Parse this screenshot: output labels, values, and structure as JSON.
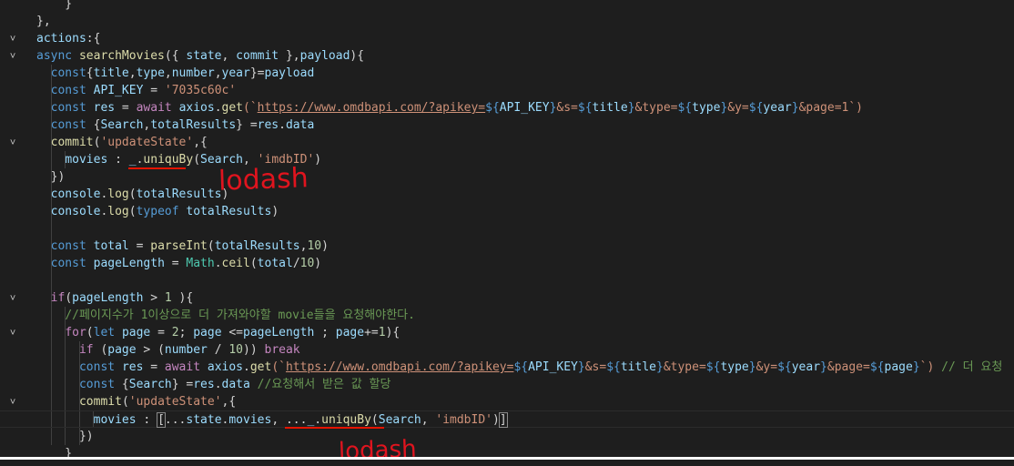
{
  "editor": {
    "lines": [
      {
        "fold": false,
        "segs": [
          {
            "t": "    }",
            "c": ""
          }
        ]
      },
      {
        "fold": false,
        "segs": [
          {
            "t": "},",
            "c": ""
          }
        ]
      },
      {
        "fold": true,
        "segs": [
          {
            "t": "actions",
            "c": "var"
          },
          {
            "t": ":{",
            "c": ""
          }
        ]
      },
      {
        "fold": true,
        "segs": [
          {
            "t": "async",
            "c": "kw"
          },
          {
            "t": " ",
            "c": ""
          },
          {
            "t": "searchMovies",
            "c": "fn"
          },
          {
            "t": "({ ",
            "c": ""
          },
          {
            "t": "state",
            "c": "var"
          },
          {
            "t": ", ",
            "c": ""
          },
          {
            "t": "commit",
            "c": "var"
          },
          {
            "t": " },",
            "c": ""
          },
          {
            "t": "payload",
            "c": "var"
          },
          {
            "t": "){",
            "c": ""
          }
        ]
      },
      {
        "fold": false,
        "segs": [
          {
            "t": "  ",
            "c": ""
          },
          {
            "t": "const",
            "c": "kw"
          },
          {
            "t": "{",
            "c": ""
          },
          {
            "t": "title",
            "c": "var"
          },
          {
            "t": ",",
            "c": ""
          },
          {
            "t": "type",
            "c": "var"
          },
          {
            "t": ",",
            "c": ""
          },
          {
            "t": "number",
            "c": "var"
          },
          {
            "t": ",",
            "c": ""
          },
          {
            "t": "year",
            "c": "var"
          },
          {
            "t": "}=",
            "c": ""
          },
          {
            "t": "payload",
            "c": "var"
          }
        ]
      },
      {
        "fold": false,
        "segs": [
          {
            "t": "  ",
            "c": ""
          },
          {
            "t": "const",
            "c": "kw"
          },
          {
            "t": " ",
            "c": ""
          },
          {
            "t": "API_KEY",
            "c": "var"
          },
          {
            "t": " = ",
            "c": ""
          },
          {
            "t": "'7035c60c'",
            "c": "str"
          }
        ]
      },
      {
        "fold": false,
        "segs": [
          {
            "t": "  ",
            "c": ""
          },
          {
            "t": "const",
            "c": "kw"
          },
          {
            "t": " ",
            "c": ""
          },
          {
            "t": "res",
            "c": "var"
          },
          {
            "t": " = ",
            "c": ""
          },
          {
            "t": "await",
            "c": "ctl"
          },
          {
            "t": " ",
            "c": ""
          },
          {
            "t": "axios",
            "c": "var"
          },
          {
            "t": ".",
            "c": ""
          },
          {
            "t": "get",
            "c": "fn"
          },
          {
            "t": "(`",
            "c": "str"
          },
          {
            "t": "https://www.omdbapi.com/?apikey=",
            "c": "link"
          },
          {
            "t": "${",
            "c": "interp"
          },
          {
            "t": "API_KEY",
            "c": "var"
          },
          {
            "t": "}",
            "c": "interp"
          },
          {
            "t": "&s=",
            "c": "str"
          },
          {
            "t": "${",
            "c": "interp"
          },
          {
            "t": "title",
            "c": "var"
          },
          {
            "t": "}",
            "c": "interp"
          },
          {
            "t": "&type=",
            "c": "str"
          },
          {
            "t": "${",
            "c": "interp"
          },
          {
            "t": "type",
            "c": "var"
          },
          {
            "t": "}",
            "c": "interp"
          },
          {
            "t": "&y=",
            "c": "str"
          },
          {
            "t": "${",
            "c": "interp"
          },
          {
            "t": "year",
            "c": "var"
          },
          {
            "t": "}",
            "c": "interp"
          },
          {
            "t": "&page=1",
            "c": "str"
          },
          {
            "t": "`)",
            "c": "str"
          }
        ]
      },
      {
        "fold": false,
        "segs": [
          {
            "t": "  ",
            "c": ""
          },
          {
            "t": "const",
            "c": "kw"
          },
          {
            "t": " {",
            "c": ""
          },
          {
            "t": "Search",
            "c": "var"
          },
          {
            "t": ",",
            "c": ""
          },
          {
            "t": "totalResults",
            "c": "var"
          },
          {
            "t": "} =",
            "c": ""
          },
          {
            "t": "res",
            "c": "var"
          },
          {
            "t": ".",
            "c": ""
          },
          {
            "t": "data",
            "c": "var"
          }
        ]
      },
      {
        "fold": true,
        "segs": [
          {
            "t": "  ",
            "c": ""
          },
          {
            "t": "commit",
            "c": "fn"
          },
          {
            "t": "(",
            "c": ""
          },
          {
            "t": "'updateState'",
            "c": "str"
          },
          {
            "t": ",{",
            "c": ""
          }
        ]
      },
      {
        "fold": false,
        "segs": [
          {
            "t": "    ",
            "c": ""
          },
          {
            "t": "movies",
            "c": "var"
          },
          {
            "t": " : ",
            "c": ""
          },
          {
            "t": "_",
            "c": "var"
          },
          {
            "t": ".",
            "c": ""
          },
          {
            "t": "uniquBy",
            "c": "fn"
          },
          {
            "t": "(",
            "c": ""
          },
          {
            "t": "Search",
            "c": "var"
          },
          {
            "t": ", ",
            "c": ""
          },
          {
            "t": "'imdbID'",
            "c": "str"
          },
          {
            "t": ")",
            "c": ""
          }
        ]
      },
      {
        "fold": false,
        "segs": [
          {
            "t": "  })",
            "c": ""
          }
        ]
      },
      {
        "fold": false,
        "segs": [
          {
            "t": "  ",
            "c": ""
          },
          {
            "t": "console",
            "c": "var"
          },
          {
            "t": ".",
            "c": ""
          },
          {
            "t": "log",
            "c": "fn"
          },
          {
            "t": "(",
            "c": ""
          },
          {
            "t": "totalResults",
            "c": "var"
          },
          {
            "t": ")",
            "c": ""
          }
        ]
      },
      {
        "fold": false,
        "segs": [
          {
            "t": "  ",
            "c": ""
          },
          {
            "t": "console",
            "c": "var"
          },
          {
            "t": ".",
            "c": ""
          },
          {
            "t": "log",
            "c": "fn"
          },
          {
            "t": "(",
            "c": ""
          },
          {
            "t": "typeof",
            "c": "kw"
          },
          {
            "t": " ",
            "c": ""
          },
          {
            "t": "totalResults",
            "c": "var"
          },
          {
            "t": ")",
            "c": ""
          }
        ]
      },
      {
        "fold": false,
        "segs": [
          {
            "t": "",
            "c": ""
          }
        ]
      },
      {
        "fold": false,
        "segs": [
          {
            "t": "  ",
            "c": ""
          },
          {
            "t": "const",
            "c": "kw"
          },
          {
            "t": " ",
            "c": ""
          },
          {
            "t": "total",
            "c": "var"
          },
          {
            "t": " = ",
            "c": ""
          },
          {
            "t": "parseInt",
            "c": "fn"
          },
          {
            "t": "(",
            "c": ""
          },
          {
            "t": "totalResults",
            "c": "var"
          },
          {
            "t": ",",
            "c": ""
          },
          {
            "t": "10",
            "c": "num"
          },
          {
            "t": ")",
            "c": ""
          }
        ]
      },
      {
        "fold": false,
        "segs": [
          {
            "t": "  ",
            "c": ""
          },
          {
            "t": "const",
            "c": "kw"
          },
          {
            "t": " ",
            "c": ""
          },
          {
            "t": "pageLength",
            "c": "var"
          },
          {
            "t": " = ",
            "c": ""
          },
          {
            "t": "Math",
            "c": "cls"
          },
          {
            "t": ".",
            "c": ""
          },
          {
            "t": "ceil",
            "c": "fn"
          },
          {
            "t": "(",
            "c": ""
          },
          {
            "t": "total",
            "c": "var"
          },
          {
            "t": "/",
            "c": ""
          },
          {
            "t": "10",
            "c": "num"
          },
          {
            "t": ")",
            "c": ""
          }
        ]
      },
      {
        "fold": false,
        "segs": [
          {
            "t": "",
            "c": ""
          }
        ]
      },
      {
        "fold": true,
        "segs": [
          {
            "t": "  ",
            "c": ""
          },
          {
            "t": "if",
            "c": "ctl"
          },
          {
            "t": "(",
            "c": ""
          },
          {
            "t": "pageLength",
            "c": "var"
          },
          {
            "t": " > ",
            "c": ""
          },
          {
            "t": "1",
            "c": "num"
          },
          {
            "t": " ){",
            "c": ""
          }
        ]
      },
      {
        "fold": false,
        "segs": [
          {
            "t": "    ",
            "c": ""
          },
          {
            "t": "//페이지수가 1이상으로 더 가져와야할 movie들을 요청해야한다.",
            "c": "cmt"
          }
        ]
      },
      {
        "fold": true,
        "segs": [
          {
            "t": "    ",
            "c": ""
          },
          {
            "t": "for",
            "c": "ctl"
          },
          {
            "t": "(",
            "c": ""
          },
          {
            "t": "let",
            "c": "kw"
          },
          {
            "t": " ",
            "c": ""
          },
          {
            "t": "page",
            "c": "var"
          },
          {
            "t": " = ",
            "c": ""
          },
          {
            "t": "2",
            "c": "num"
          },
          {
            "t": "; ",
            "c": ""
          },
          {
            "t": "page",
            "c": "var"
          },
          {
            "t": " <=",
            "c": ""
          },
          {
            "t": "pageLength",
            "c": "var"
          },
          {
            "t": " ; ",
            "c": ""
          },
          {
            "t": "page",
            "c": "var"
          },
          {
            "t": "+=",
            "c": ""
          },
          {
            "t": "1",
            "c": "num"
          },
          {
            "t": "){",
            "c": ""
          }
        ]
      },
      {
        "fold": false,
        "segs": [
          {
            "t": "      ",
            "c": ""
          },
          {
            "t": "if",
            "c": "ctl"
          },
          {
            "t": " (",
            "c": ""
          },
          {
            "t": "page",
            "c": "var"
          },
          {
            "t": " > (",
            "c": ""
          },
          {
            "t": "number",
            "c": "var"
          },
          {
            "t": " / ",
            "c": ""
          },
          {
            "t": "10",
            "c": "num"
          },
          {
            "t": ")) ",
            "c": ""
          },
          {
            "t": "break",
            "c": "ctl"
          }
        ]
      },
      {
        "fold": false,
        "segs": [
          {
            "t": "      ",
            "c": ""
          },
          {
            "t": "const",
            "c": "kw"
          },
          {
            "t": " ",
            "c": ""
          },
          {
            "t": "res",
            "c": "var"
          },
          {
            "t": " = ",
            "c": ""
          },
          {
            "t": "await",
            "c": "ctl"
          },
          {
            "t": " ",
            "c": ""
          },
          {
            "t": "axios",
            "c": "var"
          },
          {
            "t": ".",
            "c": ""
          },
          {
            "t": "get",
            "c": "fn"
          },
          {
            "t": "(`",
            "c": "str"
          },
          {
            "t": "https://www.omdbapi.com/?apikey=",
            "c": "link"
          },
          {
            "t": "${",
            "c": "interp"
          },
          {
            "t": "API_KEY",
            "c": "var"
          },
          {
            "t": "}",
            "c": "interp"
          },
          {
            "t": "&s=",
            "c": "str"
          },
          {
            "t": "${",
            "c": "interp"
          },
          {
            "t": "title",
            "c": "var"
          },
          {
            "t": "}",
            "c": "interp"
          },
          {
            "t": "&type=",
            "c": "str"
          },
          {
            "t": "${",
            "c": "interp"
          },
          {
            "t": "type",
            "c": "var"
          },
          {
            "t": "}",
            "c": "interp"
          },
          {
            "t": "&y=",
            "c": "str"
          },
          {
            "t": "${",
            "c": "interp"
          },
          {
            "t": "year",
            "c": "var"
          },
          {
            "t": "}",
            "c": "interp"
          },
          {
            "t": "&page=",
            "c": "str"
          },
          {
            "t": "${",
            "c": "interp"
          },
          {
            "t": "page",
            "c": "var"
          },
          {
            "t": "}",
            "c": "interp"
          },
          {
            "t": "`)",
            "c": "str"
          },
          {
            "t": " // 더 요청",
            "c": "cmt"
          }
        ]
      },
      {
        "fold": false,
        "segs": [
          {
            "t": "      ",
            "c": ""
          },
          {
            "t": "const",
            "c": "kw"
          },
          {
            "t": " {",
            "c": ""
          },
          {
            "t": "Search",
            "c": "var"
          },
          {
            "t": "} =",
            "c": ""
          },
          {
            "t": "res",
            "c": "var"
          },
          {
            "t": ".",
            "c": ""
          },
          {
            "t": "data",
            "c": "var"
          },
          {
            "t": " //요청해서 받은 값 할당",
            "c": "cmt"
          }
        ]
      },
      {
        "fold": true,
        "segs": [
          {
            "t": "      ",
            "c": ""
          },
          {
            "t": "commit",
            "c": "fn"
          },
          {
            "t": "(",
            "c": ""
          },
          {
            "t": "'updateState'",
            "c": "str"
          },
          {
            "t": ",{",
            "c": ""
          }
        ]
      },
      {
        "fold": false,
        "current": true,
        "segs": [
          {
            "t": "        ",
            "c": ""
          },
          {
            "t": "movies",
            "c": "var"
          },
          {
            "t": " : ",
            "c": ""
          },
          {
            "t": "[",
            "c": "box"
          },
          {
            "t": "...",
            "c": ""
          },
          {
            "t": "state",
            "c": "var"
          },
          {
            "t": ".",
            "c": ""
          },
          {
            "t": "movies",
            "c": "var"
          },
          {
            "t": ", ",
            "c": ""
          },
          {
            "t": "...",
            "c": ""
          },
          {
            "t": "_",
            "c": "var"
          },
          {
            "t": ".",
            "c": ""
          },
          {
            "t": "uniquBy",
            "c": "fn"
          },
          {
            "t": "(",
            "c": ""
          },
          {
            "t": "Search",
            "c": "var"
          },
          {
            "t": ", ",
            "c": ""
          },
          {
            "t": "'imdbID'",
            "c": "str"
          },
          {
            "t": ")",
            "c": ""
          },
          {
            "t": "]",
            "c": "box"
          }
        ]
      },
      {
        "fold": false,
        "segs": [
          {
            "t": "      })",
            "c": ""
          }
        ]
      },
      {
        "fold": false,
        "segs": [
          {
            "t": "    }",
            "c": ""
          }
        ]
      }
    ]
  },
  "annotations": {
    "first": "lodash",
    "second": "lodash"
  },
  "colors": {
    "background": "#1e1e1e",
    "annotation": "#e0141e"
  }
}
